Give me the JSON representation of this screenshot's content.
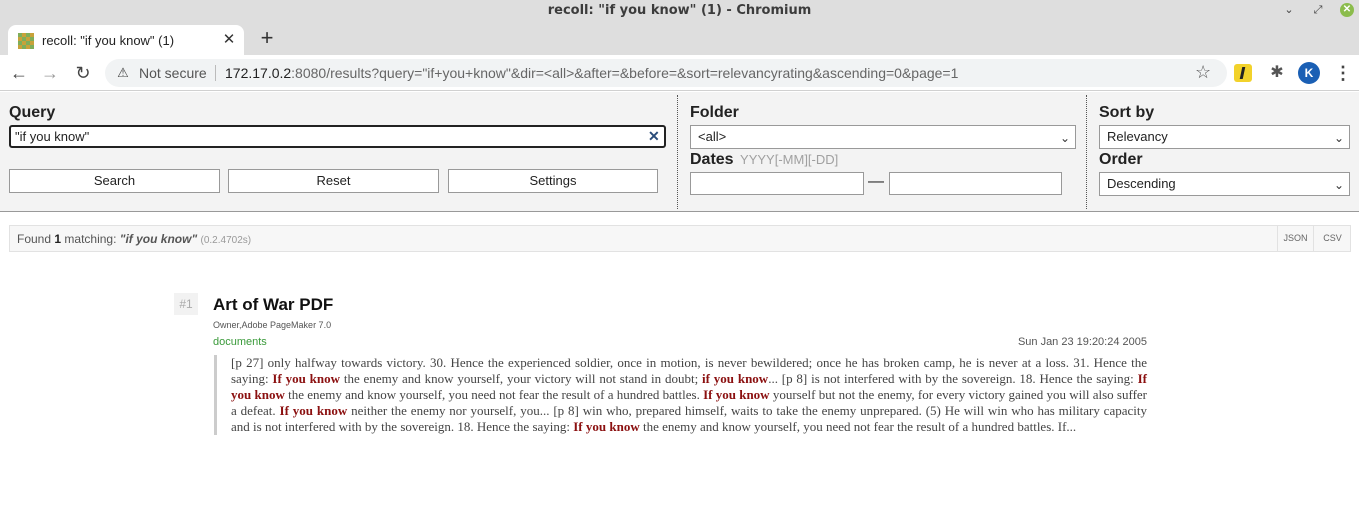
{
  "window": {
    "title": "recoll: \"if you know\" (1) - Chromium"
  },
  "tabs": [
    {
      "label": "recoll: \"if you know\" (1)"
    }
  ],
  "addressbar": {
    "security": "Not secure",
    "url_host": "172.17.0.2",
    "url_rest": ":8080/results?query=\"if+you+know\"&dir=<all>&after=&before=&sort=relevancyrating&ascending=0&page=1",
    "profile_initial": "K"
  },
  "search_panel": {
    "query_label": "Query",
    "query_value": "\"if you know\"",
    "clear_symbol": "✕",
    "buttons": {
      "search": "Search",
      "reset": "Reset",
      "settings": "Settings"
    },
    "folder_label": "Folder",
    "folder_value": "<all>",
    "dates_label": "Dates",
    "dates_hint": "YYYY[-MM][-DD]",
    "date_separator": "—",
    "sort_label": "Sort by",
    "sort_value": "Relevancy",
    "order_label": "Order",
    "order_value": "Descending"
  },
  "results_bar": {
    "prefix": "Found",
    "count": "1",
    "matching": "matching:",
    "query": "\"if you know\"",
    "timing": "(0.2.4702s)",
    "json_label": "JSON",
    "csv_label": "CSV"
  },
  "results": [
    {
      "rank": "#1",
      "title": "Art of War PDF",
      "author": "Owner,Adobe PageMaker 7.0",
      "folder": "documents",
      "date": "Sun Jan 23 19:20:24 2005",
      "snippet": [
        {
          "text": "[p 27] only halfway towards victory. 30. Hence the experienced soldier, once in motion, is never bewildered; once he has broken camp, he is never at a loss. 31. Hence the saying: ",
          "hl": false
        },
        {
          "text": "If you know",
          "hl": true
        },
        {
          "text": " the enemy and know yourself, your victory will not stand in doubt; ",
          "hl": false
        },
        {
          "text": "if you know",
          "hl": true
        },
        {
          "text": "... [p 8] is not interfered with by the sovereign. 18. Hence the saying: ",
          "hl": false
        },
        {
          "text": "If you know",
          "hl": true
        },
        {
          "text": " the enemy and know yourself, you need not fear the result of a hundred battles. ",
          "hl": false
        },
        {
          "text": "If you know",
          "hl": true
        },
        {
          "text": " yourself but not the enemy, for every victory gained you will also suffer a defeat. ",
          "hl": false
        },
        {
          "text": "If you know",
          "hl": true
        },
        {
          "text": " neither the enemy nor yourself, you... [p 8] win who, prepared himself, waits to take the enemy unprepared. (5) He will win who has military capacity and is not interfered with by the sovereign. 18. Hence the saying: ",
          "hl": false
        },
        {
          "text": "If you know",
          "hl": true
        },
        {
          "text": " the enemy and know yourself, you need not fear the result of a hundred battles. If...",
          "hl": false
        }
      ]
    }
  ],
  "colors": {
    "highlight": "#8b1010",
    "folder_link": "#3a9a3a",
    "panel_bg": "#f3f3f3"
  }
}
